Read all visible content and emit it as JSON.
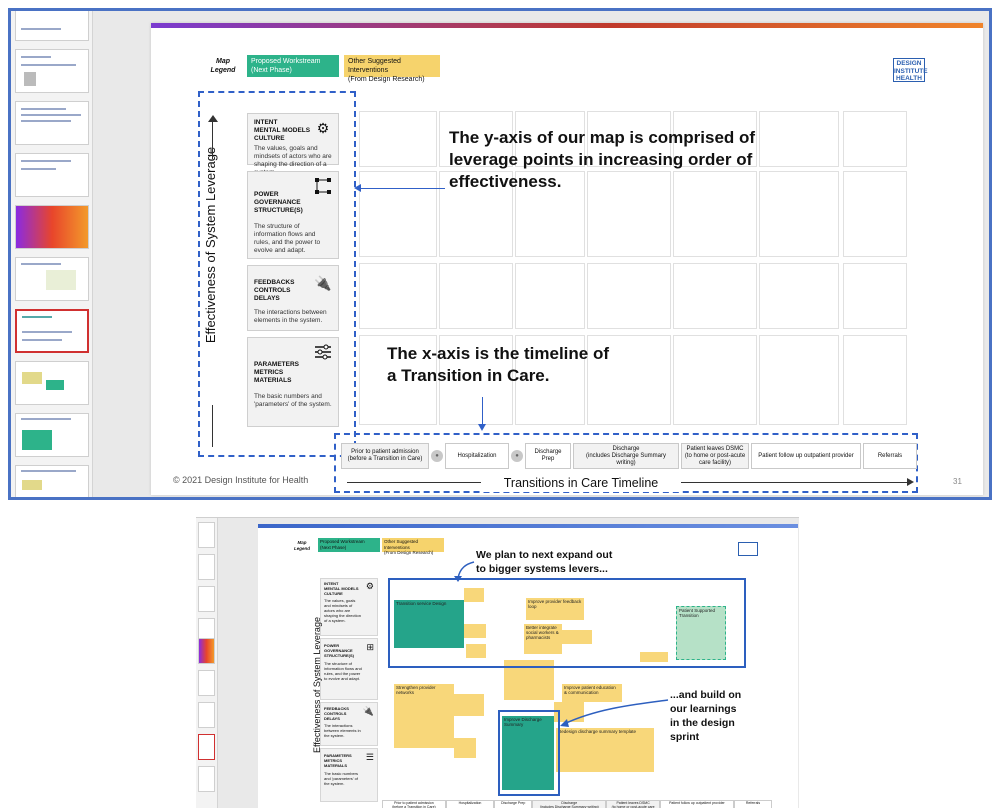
{
  "top": {
    "legend": {
      "label": "Map\nLegend",
      "proposed": "Proposed Workstream\n(Next Phase)",
      "other": "Other Suggested Interventions\n(From Design Research)",
      "proposed_color": "#2db38a",
      "other_color": "#f6d36c"
    },
    "logo": "DESIGN\nINSTITUTE\nHEALTH",
    "y_axis_label": "Effectiveness of System Leverage",
    "rows": [
      {
        "title": "INTENT\nMENTAL MODELS\nCULTURE",
        "desc": "The values, goals and mindsets of actors who are shaping the direction of a system.",
        "icon": "head-gear-icon"
      },
      {
        "title": "POWER\nGOVERNANCE\nSTRUCTURE(S)",
        "desc": "The structure of information flows and rules, and the power to evolve and adapt.",
        "icon": "network-icon"
      },
      {
        "title": "FEEDBACKS\nCONTROLS\nDELAYS",
        "desc": "The interactions between elements in the system.",
        "icon": "plug-icon"
      },
      {
        "title": "PARAMETERS\nMETRICS\nMATERIALS",
        "desc": "The basic numbers and 'parameters' of the system.",
        "icon": "sliders-icon"
      }
    ],
    "annotation_y": "The y-axis of our map is comprised of\nleverage points in increasing order of\neffectiveness.",
    "annotation_x": "The x-axis is the timeline of\na Transition in Care.",
    "timeline": [
      "Prior to patient admission\n(before a Transition in Care)",
      "Hospitalization",
      "Discharge Prep",
      "Discharge\n(includes Discharge Summary writing)",
      "Patient leaves DSMC\n(to home or post-acute care facility)",
      "Patient follow up outpatient provider",
      "Referrals"
    ],
    "timeline_label": "Transitions in Care Timeline",
    "copyright": "© 2021 Design Institute for Health",
    "page_number": "31"
  },
  "bottom": {
    "legend_label": "Map\nLegend",
    "proposed": "Proposed Workstream\n(Next Phase)",
    "other": "Other Suggested Interventions\n(From Design Research)",
    "y_axis_label": "Effectiveness of System Leverage",
    "anno_top": "We plan to next expand out\nto bigger systems levers...",
    "anno_right": "...and build on\nour learnings\nin the design\nsprint",
    "rows": [
      {
        "title": "INTENT\nMENTAL MODELS\nCULTURE",
        "desc": "The values, goals and mindsets of actors who are shaping the direction of a system."
      },
      {
        "title": "POWER\nGOVERNANCE\nSTRUCTURE(S)",
        "desc": "The structure of information flows and rules, and the power to evolve and adapt."
      },
      {
        "title": "FEEDBACKS\nCONTROLS\nDELAYS",
        "desc": "The interactions between elements in the system."
      },
      {
        "title": "PARAMETERS\nMETRICS\nMATERIALS",
        "desc": "The basic numbers and 'parameters' of the system."
      }
    ],
    "stickies": {
      "transition_service": "Transition service Design",
      "patient_support": "Patient Supported Transition",
      "improve_provider_feedback": "Improve provider feedback loop",
      "better_integrate": "Better integrate social workers & pharmacists",
      "strengthen_networks": "Strengthen provider networks",
      "improve_education": "Improve patient education & communication",
      "redesign_summary": "Redesign discharge summary template",
      "improve_discharge": "Improve Discharge Summary"
    },
    "timeline": [
      "Prior to patient admission\n(before a Transition in Care)",
      "Hospitalization",
      "Discharge Prep",
      "Discharge\n(includes Discharge Summary writing)",
      "Patient leaves DSMC\n(to home or post-acute care facility)",
      "Patient follow up outpatient provider",
      "Referrals"
    ]
  }
}
